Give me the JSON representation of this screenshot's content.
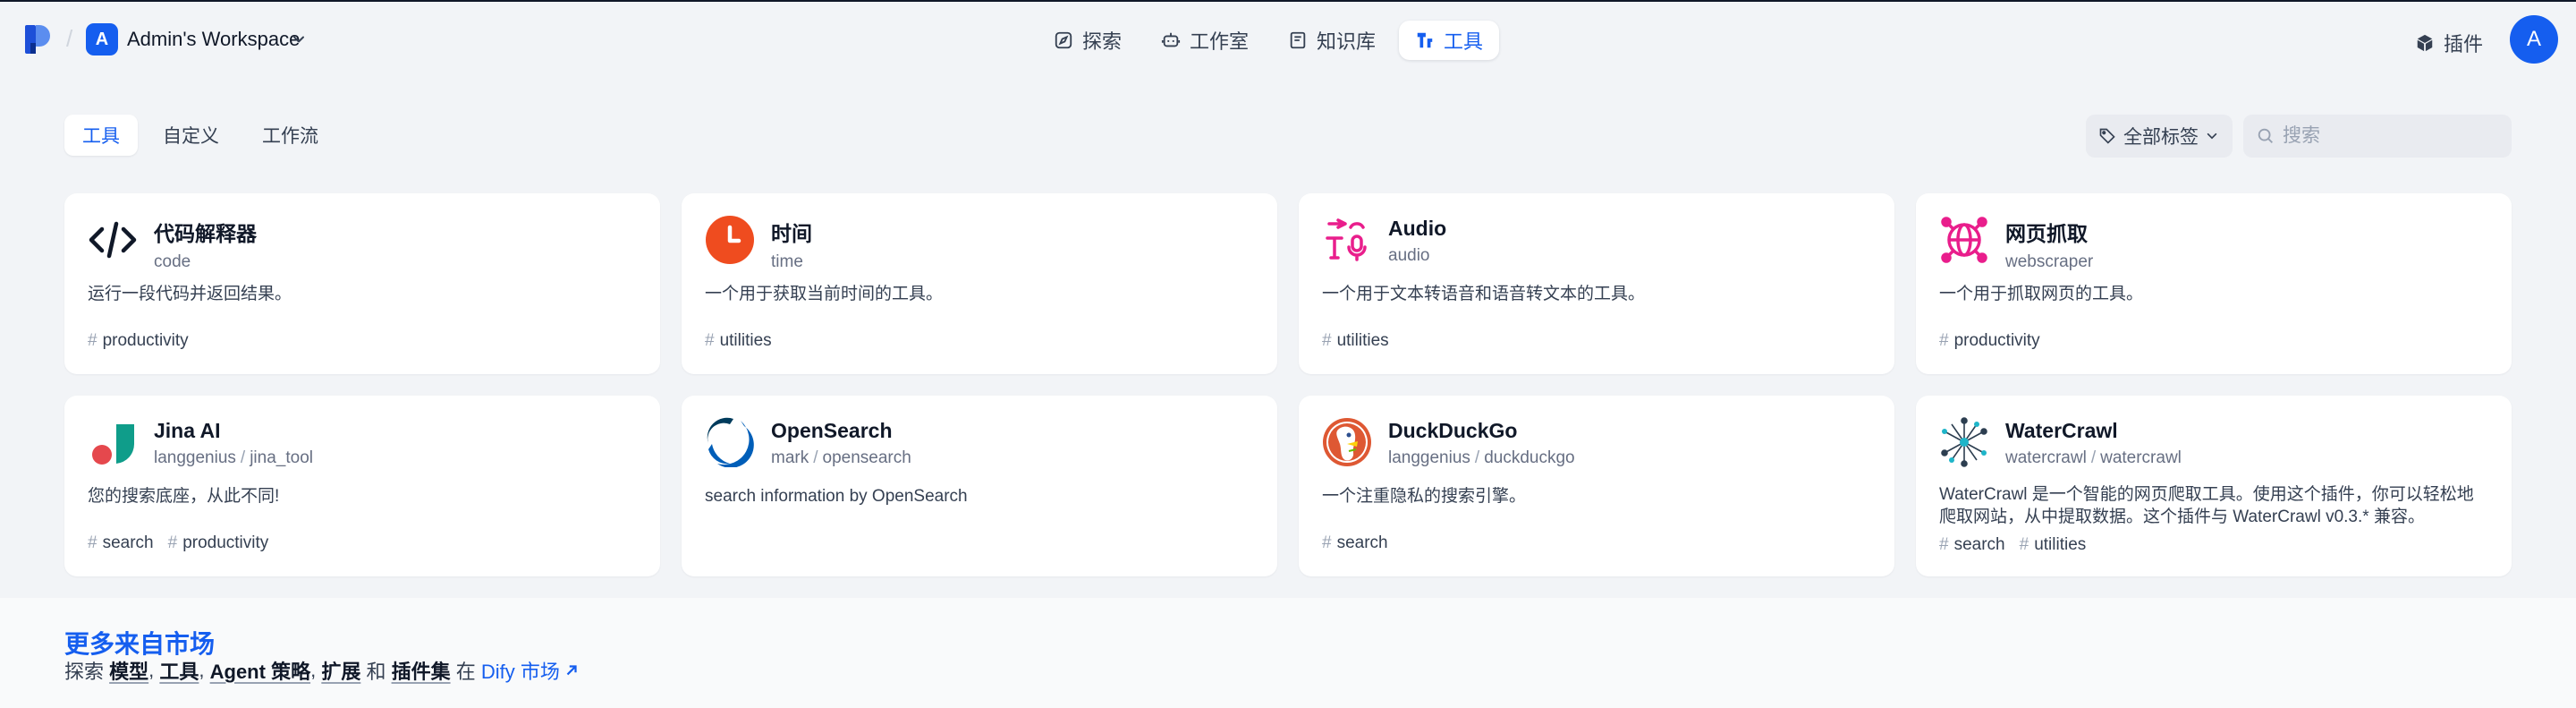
{
  "header": {
    "workspace_initial": "A",
    "workspace_name": "Admin's Workspace",
    "nav": [
      {
        "label": "探索",
        "icon": "compass-icon"
      },
      {
        "label": "工作室",
        "icon": "robot-icon"
      },
      {
        "label": "知识库",
        "icon": "book-icon"
      },
      {
        "label": "工具",
        "icon": "tool-icon",
        "active": true
      }
    ],
    "plugins_label": "插件",
    "user_initial": "A"
  },
  "filters": {
    "tabs": [
      {
        "label": "工具",
        "active": true
      },
      {
        "label": "自定义"
      },
      {
        "label": "工作流"
      }
    ],
    "tag_filter_label": "全部标签",
    "search_placeholder": "搜索"
  },
  "tools": [
    {
      "title": "代码解释器",
      "org": "",
      "name": "code",
      "desc": "运行一段代码并返回结果。",
      "tags": [
        "productivity"
      ],
      "icon": "code-icon"
    },
    {
      "title": "时间",
      "org": "",
      "name": "time",
      "desc": "一个用于获取当前时间的工具。",
      "tags": [
        "utilities"
      ],
      "icon": "clock-icon"
    },
    {
      "title": "Audio",
      "org": "",
      "name": "audio",
      "desc": "一个用于文本转语音和语音转文本的工具。",
      "tags": [
        "utilities"
      ],
      "icon": "audio-icon"
    },
    {
      "title": "网页抓取",
      "org": "",
      "name": "webscraper",
      "desc": "一个用于抓取网页的工具。",
      "tags": [
        "productivity"
      ],
      "icon": "globe-icon"
    },
    {
      "title": "Jina AI",
      "org": "langgenius",
      "name": "jina_tool",
      "desc": "您的搜索底座，从此不同!",
      "tags": [
        "search",
        "productivity"
      ],
      "icon": "jina-logo-icon"
    },
    {
      "title": "OpenSearch",
      "org": "mark",
      "name": "opensearch",
      "desc": "search information by OpenSearch",
      "tags": [],
      "icon": "opensearch-logo-icon"
    },
    {
      "title": "DuckDuckGo",
      "org": "langgenius",
      "name": "duckduckgo",
      "desc": "一个注重隐私的搜索引擎。",
      "tags": [
        "search"
      ],
      "icon": "duckduckgo-logo-icon"
    },
    {
      "title": "WaterCrawl",
      "org": "watercrawl",
      "name": "watercrawl",
      "desc": "WaterCrawl 是一个智能的网页爬取工具。使用这个插件，你可以轻松地爬取网站，从中提取数据。这个插件与 WaterCrawl v0.3.* 兼容。",
      "tags": [
        "search",
        "utilities"
      ],
      "icon": "watercrawl-logo-icon"
    }
  ],
  "marketplace": {
    "title": "更多来自市场",
    "prefix": "探索 ",
    "kw_models": "模型",
    "comma1": ", ",
    "kw_tools": "工具",
    "comma2": ", ",
    "kw_agent": "Agent 策略",
    "comma3": ", ",
    "kw_ext": "扩展",
    "and": " 和 ",
    "kw_bundles": "插件集",
    "in": " 在 ",
    "link_label": "Dify 市场"
  },
  "colors": {
    "accent": "#155eef",
    "clock": "#ef4c1f",
    "audio": "#e91e8c",
    "jina_red": "#e5484d",
    "jina_teal": "#0f9d8a",
    "opensearch_blue": "#005eb8",
    "duck_orange": "#de5833"
  }
}
